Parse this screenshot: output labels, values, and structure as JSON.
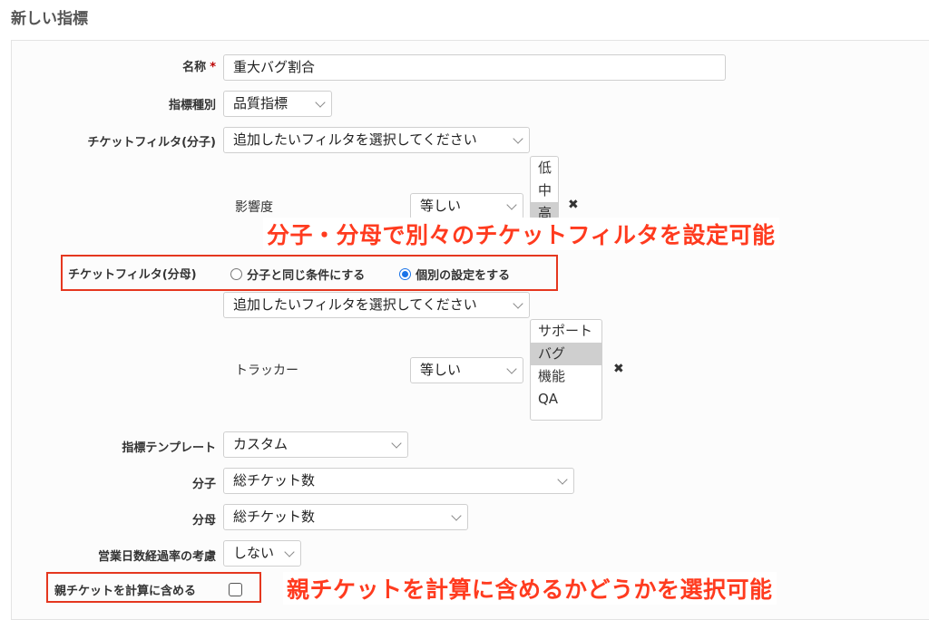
{
  "page": {
    "title": "新しい指標"
  },
  "form": {
    "name": {
      "label": "名称",
      "required_mark": "*",
      "value": "重大バグ割合"
    },
    "metric_type": {
      "label": "指標種別",
      "value": "品質指標"
    },
    "numerator_filter": {
      "label": "チケットフィルタ(分子)",
      "add_filter_value": "追加したいフィルタを選択してください",
      "filter": {
        "label": "影響度",
        "operator": "等しい",
        "options": [
          "低",
          "中",
          "高"
        ],
        "selected": "高"
      }
    },
    "denominator_filter": {
      "label": "チケットフィルタ(分母)",
      "option_same": "分子と同じ条件にする",
      "option_individual": "個別の設定をする",
      "selected": "個別の設定をする",
      "add_filter_value": "追加したいフィルタを選択してください",
      "filter": {
        "label": "トラッカー",
        "operator": "等しい",
        "options": [
          "サポート",
          "バグ",
          "機能",
          "QA"
        ],
        "selected": "バグ"
      }
    },
    "template": {
      "label": "指標テンプレート",
      "value": "カスタム"
    },
    "numerator": {
      "label": "分子",
      "value": "総チケット数"
    },
    "denominator": {
      "label": "分母",
      "value": "総チケット数"
    },
    "business_days": {
      "label": "営業日数経過率の考慮",
      "value": "しない"
    },
    "include_parent": {
      "label": "親チケットを計算に含める",
      "checked": false
    }
  },
  "annotations": {
    "filter_callout": "分子・分母で別々のチケットフィルタを設定可能",
    "parent_callout": "親チケットを計算に含めるかどうかを選択可能"
  },
  "icons": {
    "remove": "✖"
  },
  "colors": {
    "callout": "#ff3b1f",
    "required": "#bb0000",
    "radio_selected": "#1a73e8"
  }
}
